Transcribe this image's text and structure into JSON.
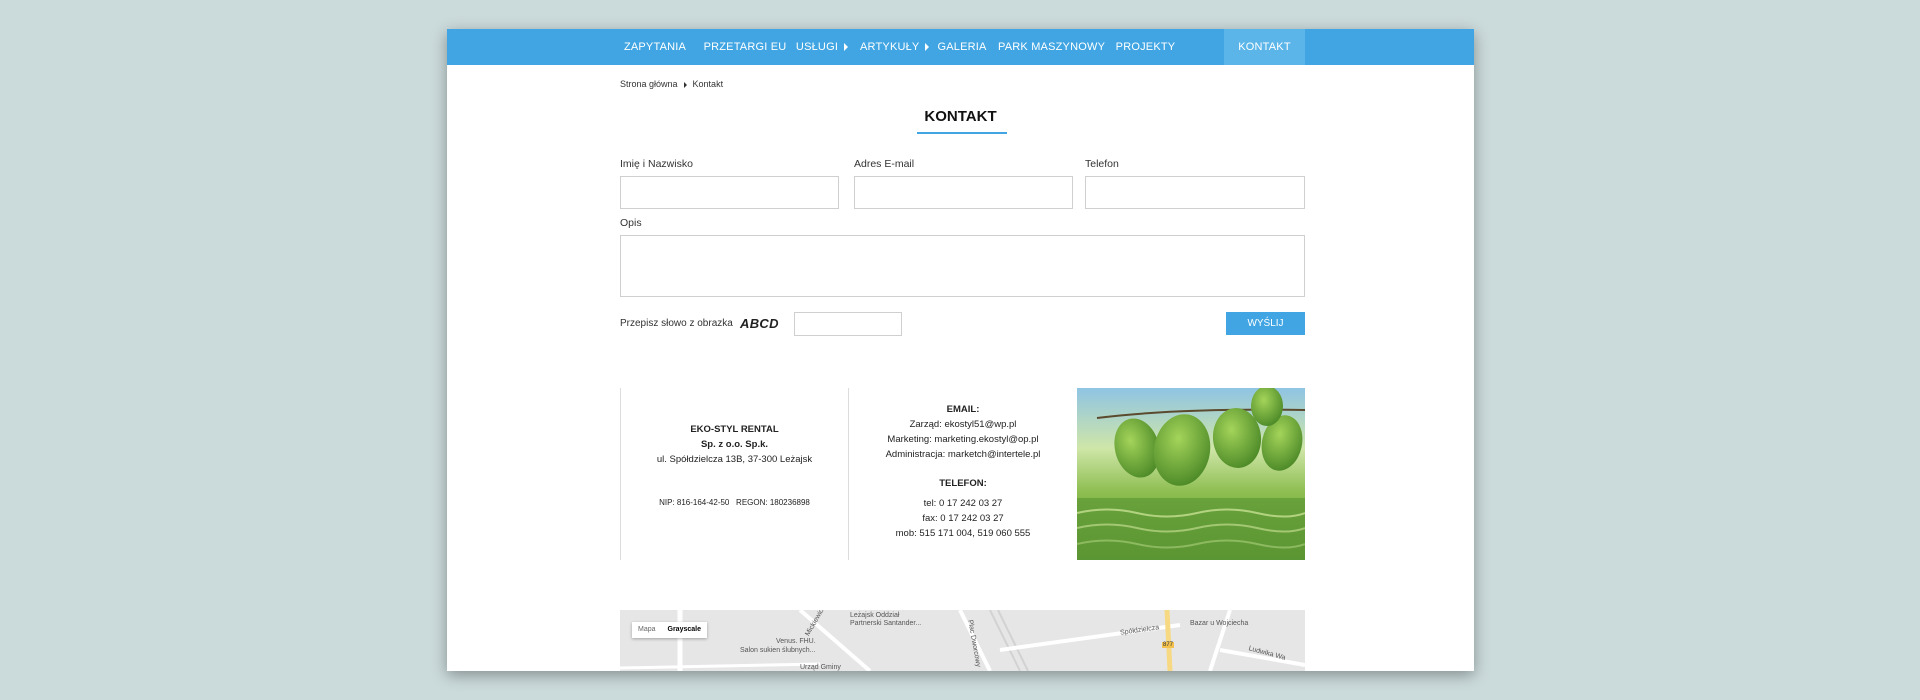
{
  "nav": {
    "items": [
      {
        "label": "ZAPYTANIA"
      },
      {
        "label": "PRZETARGI EU"
      },
      {
        "label": "USŁUGI"
      },
      {
        "label": "ARTYKUŁY"
      },
      {
        "label": "GALERIA"
      },
      {
        "label": "PARK MASZYNOWY"
      },
      {
        "label": "PROJEKTY"
      },
      {
        "label": "KONTAKT"
      }
    ]
  },
  "breadcrumb": {
    "home": "Strona główna",
    "current": "Kontakt"
  },
  "page_title": "KONTAKT",
  "form": {
    "name_label": "Imię i Nazwisko",
    "email_label": "Adres E-mail",
    "phone_label": "Telefon",
    "desc_label": "Opis",
    "captcha_label": "Przepisz słowo z obrazka",
    "captcha_word": "ABCD",
    "submit_label": "WYŚLIJ",
    "name_value": "",
    "email_value": "",
    "phone_value": "",
    "desc_value": "",
    "captcha_value": ""
  },
  "company": {
    "name": "EKO-STYL RENTAL",
    "legal": "Sp. z o.o. Sp.k.",
    "address": "ul. Spółdzielcza 13B, 37-300 Leżajsk",
    "nip": "NIP: 816-164-42-50",
    "regon": "REGON:  180236898"
  },
  "contact": {
    "email_heading": "EMAIL:",
    "email_lines": [
      "Zarząd: ekostyl51@wp.pl",
      "Marketing: marketing.ekostyl@op.pl",
      "Administracja: marketch@intertele.pl"
    ],
    "phone_heading": "TELEFON:",
    "phone_lines": [
      "tel: 0 17 242 03 27",
      "fax: 0 17 242 03 27",
      "mob: 515 171 004, 519 060 555"
    ]
  },
  "map": {
    "type_map": "Mapa",
    "type_gray": "Grayscale",
    "labels": [
      "Leżajsk Oddział",
      "Partnerski Santander...",
      "Venus. FHU.",
      "Salon sukien ślubnych...",
      "Bazar u Wojciecha",
      "Urząd Gminy",
      "Spółdzielcza",
      "Plac Dworcowy",
      "Mickiewicza",
      "Ludwika Wa",
      "877"
    ]
  },
  "colors": {
    "accent": "#40a5e2",
    "accent_active": "#5cb5e9",
    "background": "#cbdadb"
  }
}
